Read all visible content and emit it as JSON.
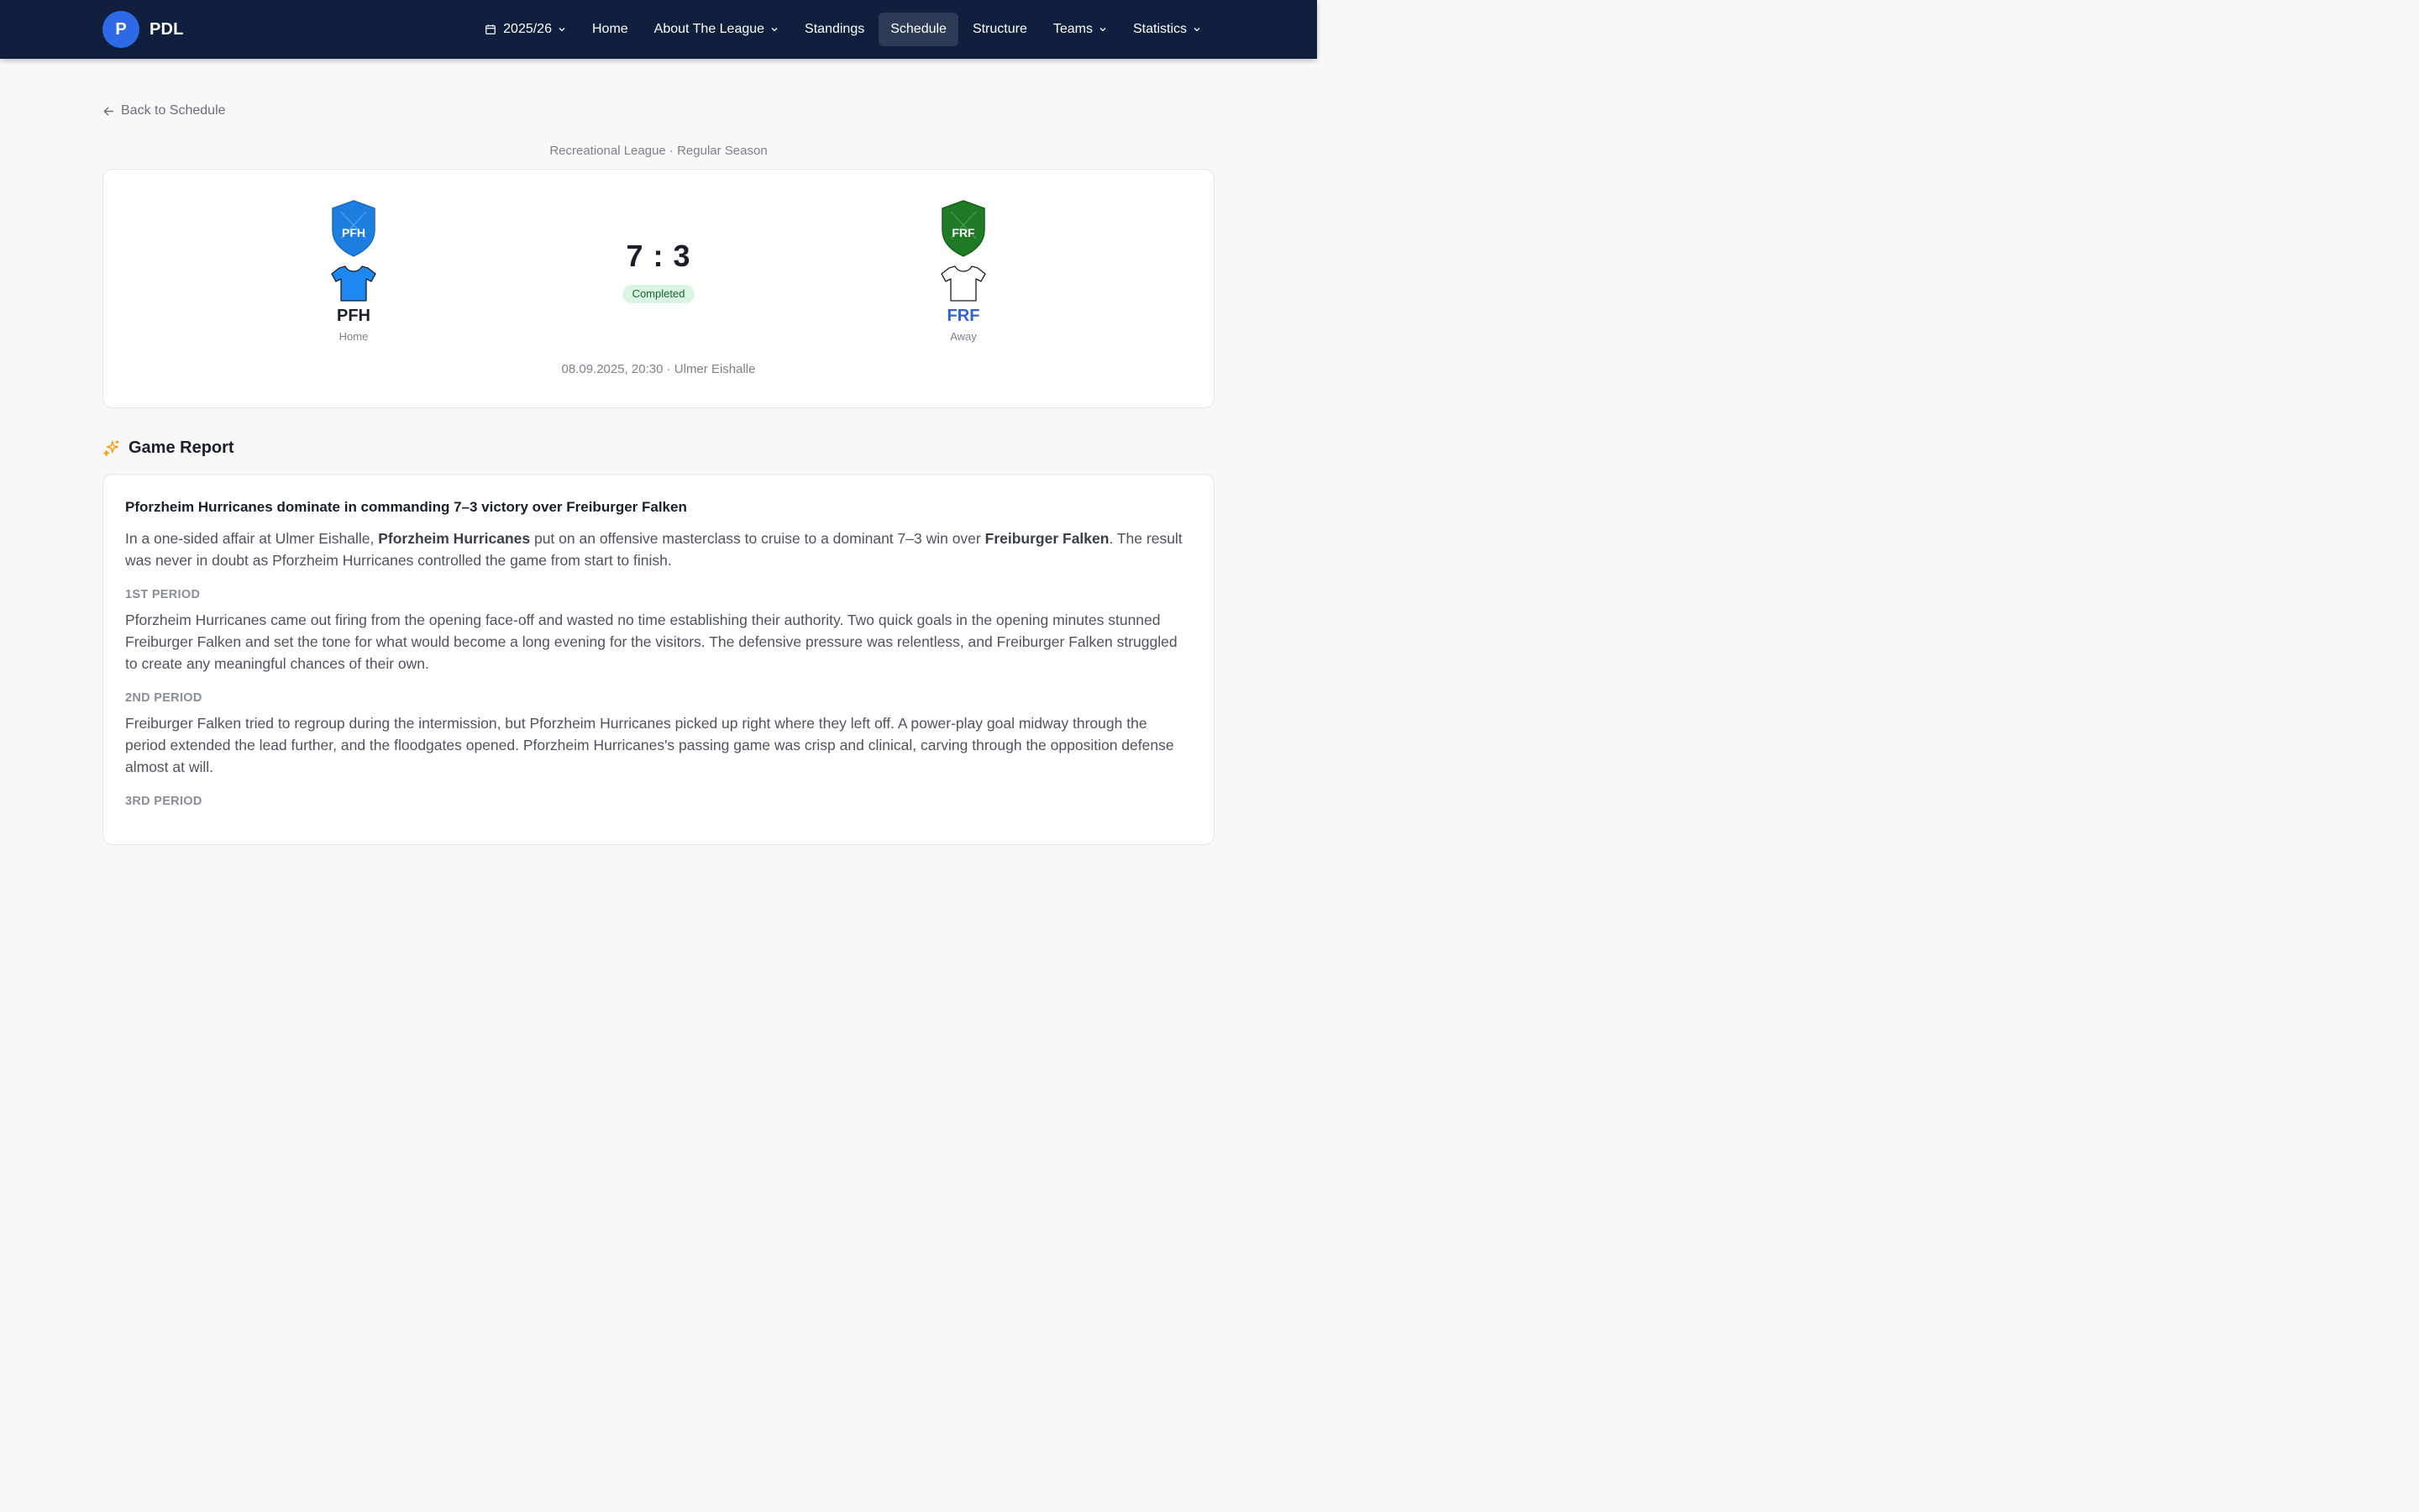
{
  "nav": {
    "brand_letter": "P",
    "brand_name": "PDL",
    "season": "2025/26",
    "items": [
      {
        "label": "Home"
      },
      {
        "label": "About The League"
      },
      {
        "label": "Standings"
      },
      {
        "label": "Schedule"
      },
      {
        "label": "Structure"
      },
      {
        "label": "Teams"
      },
      {
        "label": "Statistics"
      }
    ],
    "active": "Schedule"
  },
  "back_label": "Back to Schedule",
  "league_line": "Recreational League · Regular Season",
  "match": {
    "home": {
      "code": "PFH",
      "side": "Home",
      "shield_text": "PFH",
      "color": "#1e7ee0",
      "shirt_color": "#1e88f0"
    },
    "away": {
      "code": "FRF",
      "side": "Away",
      "shield_text": "FRF",
      "color": "#1f7a25",
      "shirt_color": "#ffffff"
    },
    "score": "7 : 3",
    "status": "Completed",
    "meta": "08.09.2025, 20:30 · Ulmer Eishalle"
  },
  "report": {
    "title": "Game Report",
    "headline": "Pforzheim Hurricanes dominate in commanding 7–3 victory over Freiburger Falken",
    "intro_a": "In a one-sided affair at Ulmer Eishalle, ",
    "intro_b": "Pforzheim Hurricanes",
    "intro_c": " put on an offensive masterclass to cruise to a dominant 7–3 win over ",
    "intro_d": "Freiburger Falken",
    "intro_e": ". The result was never in doubt as Pforzheim Hurricanes controlled the game from start to finish.",
    "sections": [
      {
        "label": "1ST PERIOD",
        "text": "Pforzheim Hurricanes came out firing from the opening face-off and wasted no time establishing their authority. Two quick goals in the opening minutes stunned Freiburger Falken and set the tone for what would become a long evening for the visitors. The defensive pressure was relentless, and Freiburger Falken struggled to create any meaningful chances of their own."
      },
      {
        "label": "2ND PERIOD",
        "text": "Freiburger Falken tried to regroup during the intermission, but Pforzheim Hurricanes picked up right where they left off. A power-play goal midway through the period extended the lead further, and the floodgates opened. Pforzheim Hurricanes's passing game was crisp and clinical, carving through the opposition defense almost at will."
      },
      {
        "label": "3RD PERIOD",
        "text": ""
      }
    ]
  }
}
